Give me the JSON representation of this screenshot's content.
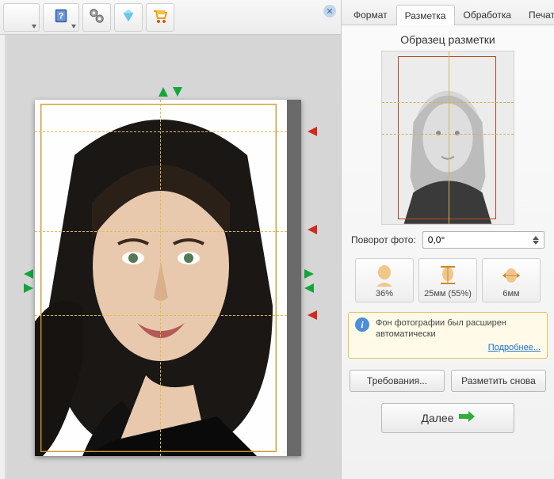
{
  "toolbar": {
    "icons": [
      "chevron-down-icon",
      "help-book-icon",
      "video-icon",
      "diamond-icon",
      "cart-icon"
    ]
  },
  "tabs": {
    "format": "Формат",
    "markup": "Разметка",
    "processing": "Обработка",
    "print": "Печать",
    "active": "markup"
  },
  "sample": {
    "title": "Образец разметки"
  },
  "rotation": {
    "label": "Поворот фото:",
    "value": "0,0°"
  },
  "metrics": {
    "head_pct": "36%",
    "head_mm": "25мм (55%)",
    "width_mm": "6мм"
  },
  "info": {
    "message": "Фон фотографии был расширен автоматически",
    "more": "Подробнее..."
  },
  "buttons": {
    "requirements": "Требования...",
    "remark": "Разметить снова",
    "next": "Далее"
  }
}
